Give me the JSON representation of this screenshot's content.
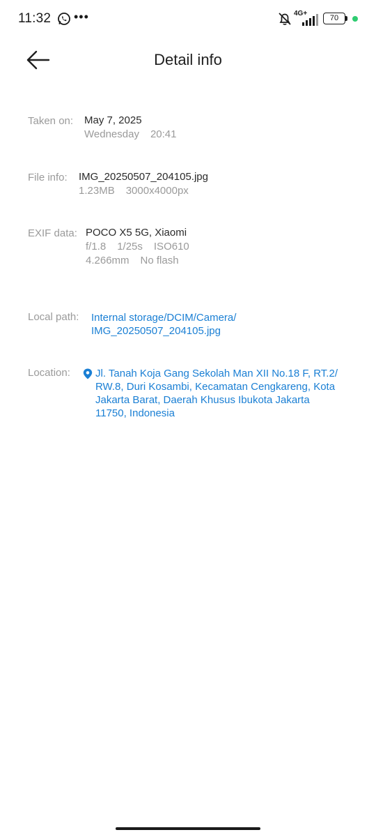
{
  "status_bar": {
    "time": "11:32",
    "overflow": "•••",
    "network": "4G+",
    "battery": "70",
    "icons": [
      "whatsapp-icon",
      "bell-off-icon",
      "signal-icon",
      "battery-icon"
    ],
    "charge_dot_color": "#2ecc71"
  },
  "header": {
    "title": "Detail info",
    "back_icon": "arrow-left-icon"
  },
  "taken_on": {
    "label": "Taken on:",
    "date": "May 7, 2025",
    "weekday": "Wednesday",
    "time": "20:41"
  },
  "file_info": {
    "label": "File info:",
    "filename": "IMG_20250507_204105.jpg",
    "size": "1.23MB",
    "resolution": "3000x4000px"
  },
  "exif": {
    "label": "EXIF data:",
    "device": "POCO X5 5G, Xiaomi",
    "aperture": "f/1.8",
    "shutter": "1/25s",
    "iso": "ISO610",
    "focal_length": "4.266mm",
    "flash": "No flash"
  },
  "local_path": {
    "label": "Local path:",
    "line1": "Internal storage/DCIM/Camera/",
    "line2": "IMG_20250507_204105.jpg"
  },
  "location": {
    "label": "Location:",
    "icon": "location-pin-icon",
    "line1": "Jl. Tanah Koja Gang Sekolah Man XII No.18 F, RT.2/",
    "line2": "RW.8, Duri Kosambi, Kecamatan Cengkareng, Kota",
    "line3": "Jakarta Barat, Daerah Khusus Ibukota Jakarta",
    "line4": "11750, Indonesia"
  },
  "colors": {
    "accent": "#1a7fd4",
    "label": "#9a9a9a",
    "text": "#2a2a2a"
  }
}
